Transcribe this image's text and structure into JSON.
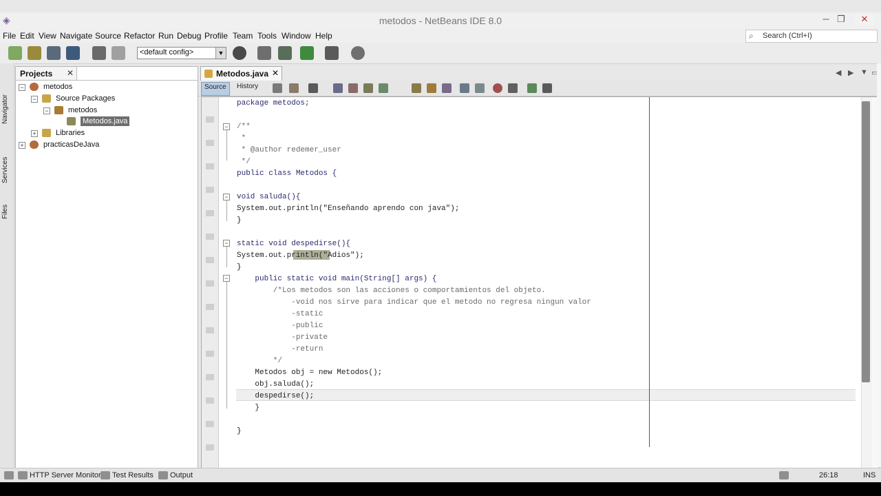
{
  "window": {
    "title": "metodos - NetBeans IDE 8.0",
    "minimize": "─",
    "maximize": "❐",
    "close": "✕"
  },
  "menu": {
    "items": [
      "File",
      "Edit",
      "View",
      "Navigate",
      "Source",
      "Refactor",
      "Run",
      "Debug",
      "Profile",
      "Team",
      "Tools",
      "Window",
      "Help"
    ],
    "search_placeholder": "Search (Ctrl+I)"
  },
  "toolbar": {
    "config": "<default config>"
  },
  "side_tabs": {
    "navigator": "Navigator",
    "services": "Services",
    "files": "Files"
  },
  "projects": {
    "tab_label": "Projects",
    "close": "✕",
    "tree": [
      {
        "label": "metodos",
        "expander": "−",
        "selected": false
      },
      {
        "label": "Source Packages",
        "expander": "−",
        "selected": false
      },
      {
        "label": "metodos",
        "expander": "−",
        "selected": false
      },
      {
        "label": "Metodos.java",
        "expander": "",
        "selected": true
      },
      {
        "label": "Libraries",
        "expander": "+",
        "selected": false
      },
      {
        "label": "practicasDeJava",
        "expander": "+",
        "selected": false
      }
    ]
  },
  "editor": {
    "tab_label": "Metodos.java",
    "tab_close": "✕",
    "source_btn": "Source",
    "history_btn": "History",
    "cursor_position": "26:18",
    "insert_mode": "INS",
    "code_lines": [
      "package metodos;",
      "",
      "/**",
      " *",
      " * @author redemer_user",
      " */",
      "public class Metodos {",
      "",
      "void saluda(){",
      "System.out.println(\"Enseñando aprendo con java\");",
      "}",
      "",
      "static void despedirse(){",
      "System.out.println(\"Adios\");",
      "}",
      "    public static void main(String[] args) {",
      "        /*Los metodos son las acciones o comportamientos del objeto.",
      "            -void nos sirve para indicar que el metodo no regresa ningun valor",
      "            -static",
      "            -public",
      "            -private",
      "            -return",
      "        */",
      "    Metodos obj = new Metodos();",
      "    obj.saluda();",
      "    despedirse();",
      "    }",
      "",
      "}"
    ]
  },
  "statusbar": {
    "items": [
      "HTTP Server Monitor",
      "Test Results",
      "Output"
    ]
  }
}
